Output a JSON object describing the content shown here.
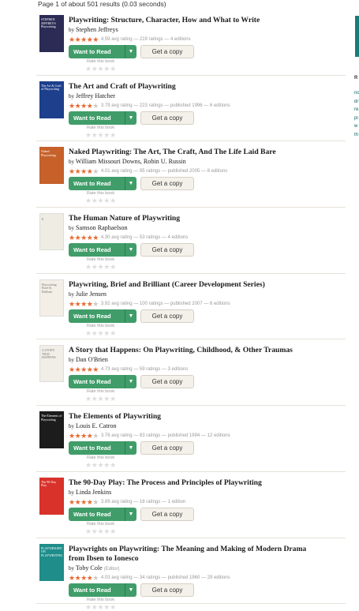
{
  "summary": "Page 1 of about 501 results (0.03 seconds)",
  "buttons": {
    "want_to_read": "Want to Read",
    "get_copy": "Get a copy",
    "rate_label": "Rate this book"
  },
  "sidebar": {
    "heading": "R",
    "lines": [
      "no",
      "dr",
      "re",
      "pl",
      "w",
      "th"
    ]
  },
  "books": [
    {
      "title": "Playwriting: Structure, Character, How and What to Write",
      "title2": "",
      "by": "by",
      "author": "Stephen Jeffreys",
      "role": "",
      "rating_stars": 4.5,
      "meta": "4.59 avg rating — 219 ratings — 4 editions",
      "cover_color": "#2b2b55",
      "cover_text": "STEPHEN JEFFREYS Playwriting"
    },
    {
      "title": "The Art and Craft of Playwriting",
      "title2": "",
      "by": "by",
      "author": "Jeffrey Hatcher",
      "role": "",
      "rating_stars": 4.0,
      "meta": "3.79 avg rating — 223 ratings — published 1996 — 6 editions",
      "cover_color": "#1d3f8c",
      "cover_text": "The Art & Craft of Playwriting"
    },
    {
      "title": "Naked Playwriting: The Art, The Craft, And The Life Laid Bare",
      "title2": "",
      "by": "by",
      "author": "William Missouri Downs, Robin U. Russin",
      "role": "",
      "rating_stars": 4.0,
      "meta": "4.01 avg rating — 95 ratings — published 2005 — 8 editions",
      "cover_color": "#c6612a",
      "cover_text": "Naked Playwriting"
    },
    {
      "title": "The Human Nature of Playwriting",
      "title2": "",
      "by": "by",
      "author": "Samson Raphaelson",
      "role": "",
      "rating_stars": 4.5,
      "meta": "4.30 avg rating — 53 ratings — 4 editions",
      "cover_color": "#efece3",
      "cover_text": "g"
    },
    {
      "title": "Playwriting, Brief and Brilliant (Career Development Series)",
      "title2": "",
      "by": "by",
      "author": "Julie Jensen",
      "role": "",
      "rating_stars": 4.0,
      "meta": "3.92 avg rating — 100 ratings — published 2007 — 6 editions",
      "cover_color": "#f3efe6",
      "cover_text": "Playwriting Brief & Brilliant"
    },
    {
      "title": "A Story that Happens: On Playwriting, Childhood, & Other Traumas",
      "title2": "",
      "by": "by",
      "author": "Dan O'Brien",
      "role": "",
      "rating_stars": 4.5,
      "meta": "4.73 avg rating — 59 ratings — 3 editions",
      "cover_color": "#f1eee8",
      "cover_text": "A STORY THAT HAPPENS"
    },
    {
      "title": "The Elements of Playwriting",
      "title2": "",
      "by": "by",
      "author": "Louis E. Catron",
      "role": "",
      "rating_stars": 3.5,
      "meta": "3.76 avg rating — 83 ratings — published 1994 — 12 editions",
      "cover_color": "#1c1c1c",
      "cover_text": "The Elements of Playwriting"
    },
    {
      "title": "The 90-Day Play: The Process and Principles of Playwriting",
      "title2": "",
      "by": "by",
      "author": "Linda Jenkins",
      "role": "",
      "rating_stars": 4.0,
      "meta": "3.89 avg rating — 18 ratings — 1 edition",
      "cover_color": "#d8322a",
      "cover_text": "The 90-Day Play"
    },
    {
      "title": "Playwrights on Playwriting: The Meaning and Making of Modern Drama",
      "title2": "from Ibsen to Ionesco",
      "by": "by",
      "author": "Toby Cole",
      "role": "(Editor)",
      "rating_stars": 4.0,
      "meta": "4.03 avg rating — 34 ratings — published 1960 — 29 editions",
      "cover_color": "#1f8d8a",
      "cover_text": "PLAYWRIGHTS ON PLAYWRITING"
    }
  ]
}
